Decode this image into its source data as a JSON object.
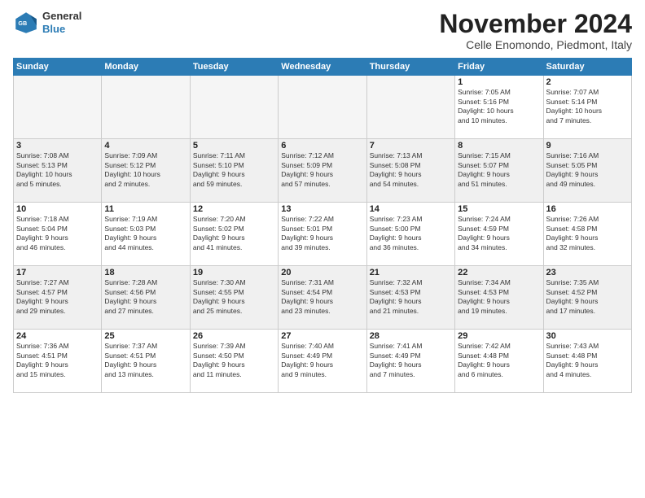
{
  "logo": {
    "line1": "General",
    "line2": "Blue"
  },
  "title": "November 2024",
  "subtitle": "Celle Enomondo, Piedmont, Italy",
  "weekdays": [
    "Sunday",
    "Monday",
    "Tuesday",
    "Wednesday",
    "Thursday",
    "Friday",
    "Saturday"
  ],
  "weeks": [
    [
      {
        "day": "",
        "info": "",
        "empty": true
      },
      {
        "day": "",
        "info": "",
        "empty": true
      },
      {
        "day": "",
        "info": "",
        "empty": true
      },
      {
        "day": "",
        "info": "",
        "empty": true
      },
      {
        "day": "",
        "info": "",
        "empty": true
      },
      {
        "day": "1",
        "info": "Sunrise: 7:05 AM\nSunset: 5:16 PM\nDaylight: 10 hours\nand 10 minutes.",
        "empty": false
      },
      {
        "day": "2",
        "info": "Sunrise: 7:07 AM\nSunset: 5:14 PM\nDaylight: 10 hours\nand 7 minutes.",
        "empty": false
      }
    ],
    [
      {
        "day": "3",
        "info": "Sunrise: 7:08 AM\nSunset: 5:13 PM\nDaylight: 10 hours\nand 5 minutes.",
        "empty": false
      },
      {
        "day": "4",
        "info": "Sunrise: 7:09 AM\nSunset: 5:12 PM\nDaylight: 10 hours\nand 2 minutes.",
        "empty": false
      },
      {
        "day": "5",
        "info": "Sunrise: 7:11 AM\nSunset: 5:10 PM\nDaylight: 9 hours\nand 59 minutes.",
        "empty": false
      },
      {
        "day": "6",
        "info": "Sunrise: 7:12 AM\nSunset: 5:09 PM\nDaylight: 9 hours\nand 57 minutes.",
        "empty": false
      },
      {
        "day": "7",
        "info": "Sunrise: 7:13 AM\nSunset: 5:08 PM\nDaylight: 9 hours\nand 54 minutes.",
        "empty": false
      },
      {
        "day": "8",
        "info": "Sunrise: 7:15 AM\nSunset: 5:07 PM\nDaylight: 9 hours\nand 51 minutes.",
        "empty": false
      },
      {
        "day": "9",
        "info": "Sunrise: 7:16 AM\nSunset: 5:05 PM\nDaylight: 9 hours\nand 49 minutes.",
        "empty": false
      }
    ],
    [
      {
        "day": "10",
        "info": "Sunrise: 7:18 AM\nSunset: 5:04 PM\nDaylight: 9 hours\nand 46 minutes.",
        "empty": false
      },
      {
        "day": "11",
        "info": "Sunrise: 7:19 AM\nSunset: 5:03 PM\nDaylight: 9 hours\nand 44 minutes.",
        "empty": false
      },
      {
        "day": "12",
        "info": "Sunrise: 7:20 AM\nSunset: 5:02 PM\nDaylight: 9 hours\nand 41 minutes.",
        "empty": false
      },
      {
        "day": "13",
        "info": "Sunrise: 7:22 AM\nSunset: 5:01 PM\nDaylight: 9 hours\nand 39 minutes.",
        "empty": false
      },
      {
        "day": "14",
        "info": "Sunrise: 7:23 AM\nSunset: 5:00 PM\nDaylight: 9 hours\nand 36 minutes.",
        "empty": false
      },
      {
        "day": "15",
        "info": "Sunrise: 7:24 AM\nSunset: 4:59 PM\nDaylight: 9 hours\nand 34 minutes.",
        "empty": false
      },
      {
        "day": "16",
        "info": "Sunrise: 7:26 AM\nSunset: 4:58 PM\nDaylight: 9 hours\nand 32 minutes.",
        "empty": false
      }
    ],
    [
      {
        "day": "17",
        "info": "Sunrise: 7:27 AM\nSunset: 4:57 PM\nDaylight: 9 hours\nand 29 minutes.",
        "empty": false
      },
      {
        "day": "18",
        "info": "Sunrise: 7:28 AM\nSunset: 4:56 PM\nDaylight: 9 hours\nand 27 minutes.",
        "empty": false
      },
      {
        "day": "19",
        "info": "Sunrise: 7:30 AM\nSunset: 4:55 PM\nDaylight: 9 hours\nand 25 minutes.",
        "empty": false
      },
      {
        "day": "20",
        "info": "Sunrise: 7:31 AM\nSunset: 4:54 PM\nDaylight: 9 hours\nand 23 minutes.",
        "empty": false
      },
      {
        "day": "21",
        "info": "Sunrise: 7:32 AM\nSunset: 4:53 PM\nDaylight: 9 hours\nand 21 minutes.",
        "empty": false
      },
      {
        "day": "22",
        "info": "Sunrise: 7:34 AM\nSunset: 4:53 PM\nDaylight: 9 hours\nand 19 minutes.",
        "empty": false
      },
      {
        "day": "23",
        "info": "Sunrise: 7:35 AM\nSunset: 4:52 PM\nDaylight: 9 hours\nand 17 minutes.",
        "empty": false
      }
    ],
    [
      {
        "day": "24",
        "info": "Sunrise: 7:36 AM\nSunset: 4:51 PM\nDaylight: 9 hours\nand 15 minutes.",
        "empty": false
      },
      {
        "day": "25",
        "info": "Sunrise: 7:37 AM\nSunset: 4:51 PM\nDaylight: 9 hours\nand 13 minutes.",
        "empty": false
      },
      {
        "day": "26",
        "info": "Sunrise: 7:39 AM\nSunset: 4:50 PM\nDaylight: 9 hours\nand 11 minutes.",
        "empty": false
      },
      {
        "day": "27",
        "info": "Sunrise: 7:40 AM\nSunset: 4:49 PM\nDaylight: 9 hours\nand 9 minutes.",
        "empty": false
      },
      {
        "day": "28",
        "info": "Sunrise: 7:41 AM\nSunset: 4:49 PM\nDaylight: 9 hours\nand 7 minutes.",
        "empty": false
      },
      {
        "day": "29",
        "info": "Sunrise: 7:42 AM\nSunset: 4:48 PM\nDaylight: 9 hours\nand 6 minutes.",
        "empty": false
      },
      {
        "day": "30",
        "info": "Sunrise: 7:43 AM\nSunset: 4:48 PM\nDaylight: 9 hours\nand 4 minutes.",
        "empty": false
      }
    ]
  ]
}
